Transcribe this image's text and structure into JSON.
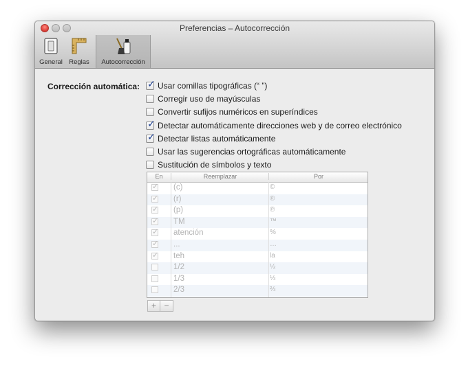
{
  "window": {
    "title": "Preferencias – Autocorrección"
  },
  "toolbar": {
    "items": [
      {
        "label": "General"
      },
      {
        "label": "Reglas"
      },
      {
        "label": "Autocorrección"
      }
    ]
  },
  "section": {
    "label": "Corrección automática:",
    "options": [
      {
        "label": "Usar comillas tipográficas (“ ”)",
        "checked": true
      },
      {
        "label": "Corregir uso de mayúsculas",
        "checked": false
      },
      {
        "label": "Convertir sufijos numéricos en superíndices",
        "checked": false
      },
      {
        "label": "Detectar automáticamente direcciones web y de correo electrónico",
        "checked": true
      },
      {
        "label": "Detectar listas automáticamente",
        "checked": true
      },
      {
        "label": "Usar las sugerencias ortográficas automáticamente",
        "checked": false
      },
      {
        "label": "Sustitución de símbolos y texto",
        "checked": false
      }
    ]
  },
  "table": {
    "headers": {
      "en": "En",
      "replace": "Reemplazar",
      "with": "Por"
    },
    "rows": [
      {
        "enabled": true,
        "replace": "(c)",
        "with": "©"
      },
      {
        "enabled": true,
        "replace": "(r)",
        "with": "®"
      },
      {
        "enabled": true,
        "replace": "(p)",
        "with": "℗"
      },
      {
        "enabled": true,
        "replace": "TM",
        "with": "™"
      },
      {
        "enabled": true,
        "replace": "atención",
        "with": "%"
      },
      {
        "enabled": true,
        "replace": "...",
        "with": "…"
      },
      {
        "enabled": true,
        "replace": "teh",
        "with": "la"
      },
      {
        "enabled": false,
        "replace": "1/2",
        "with": "½"
      },
      {
        "enabled": false,
        "replace": "1/3",
        "with": "⅓"
      },
      {
        "enabled": false,
        "replace": "2/3",
        "with": "⅔"
      }
    ]
  },
  "buttons": {
    "add": "+",
    "remove": "−"
  }
}
